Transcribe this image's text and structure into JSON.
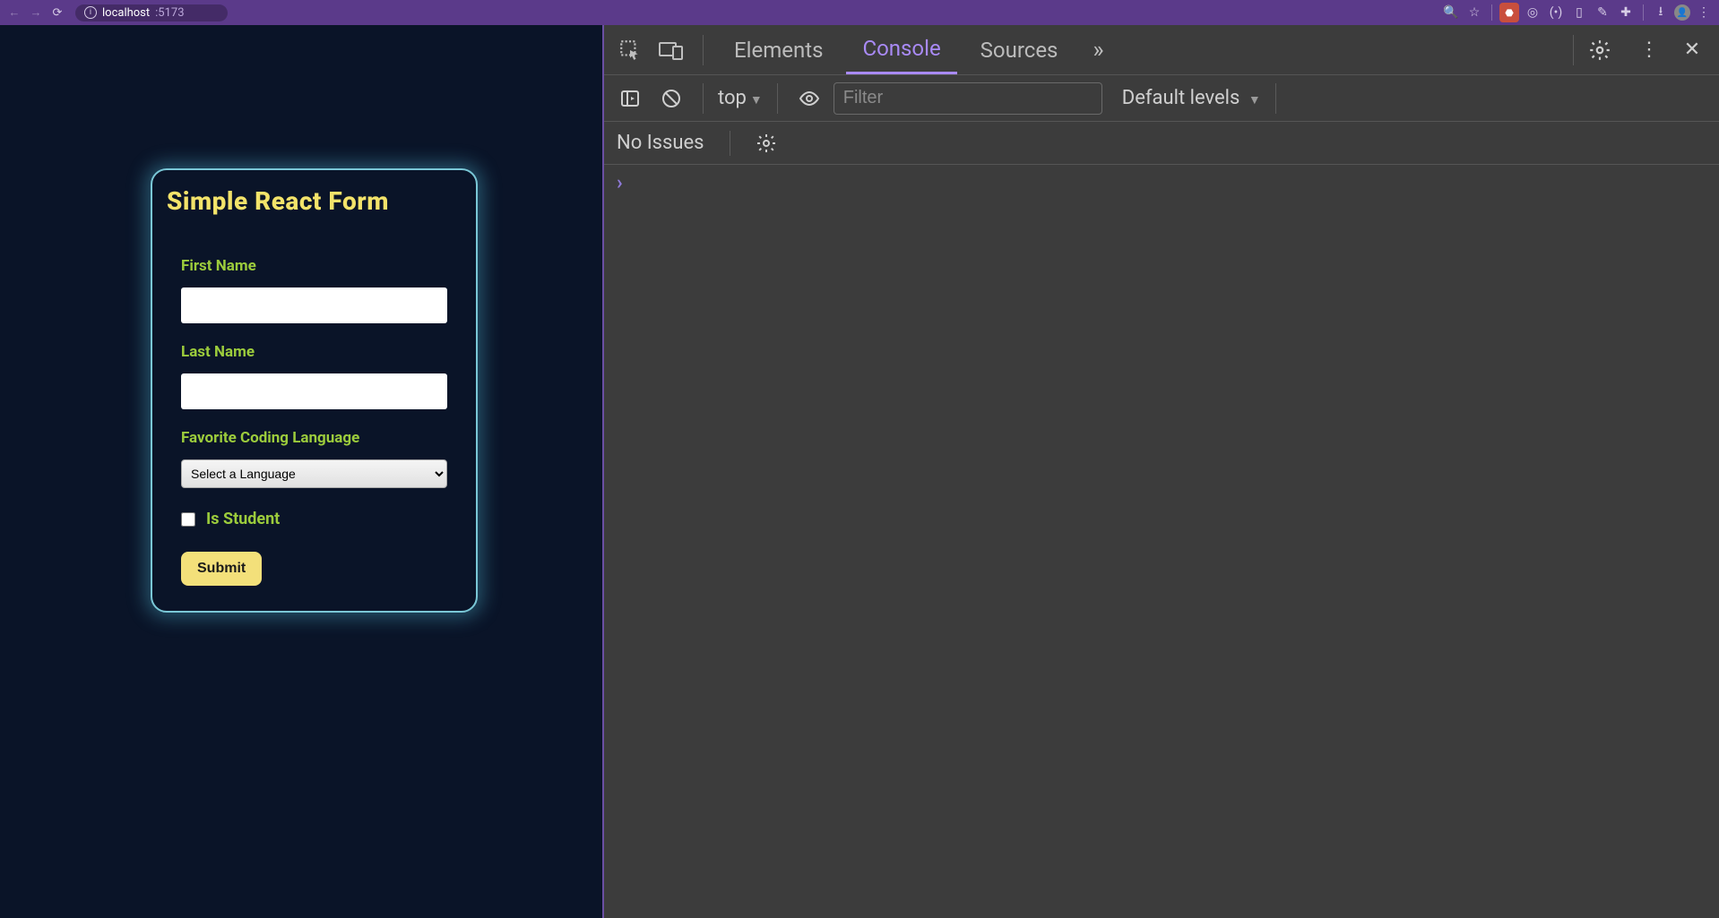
{
  "browser": {
    "url_host": "localhost",
    "url_port": ":5173"
  },
  "form": {
    "title": "Simple React Form",
    "first_name_label": "First Name",
    "first_name_value": "",
    "last_name_label": "Last Name",
    "last_name_value": "",
    "language_label": "Favorite Coding Language",
    "language_selected": "Select a Language",
    "is_student_label": "Is Student",
    "submit_label": "Submit"
  },
  "devtools": {
    "tabs": {
      "elements": "Elements",
      "console": "Console",
      "sources": "Sources"
    },
    "context": "top",
    "filter_placeholder": "Filter",
    "levels": "Default levels",
    "issues": "No Issues"
  }
}
